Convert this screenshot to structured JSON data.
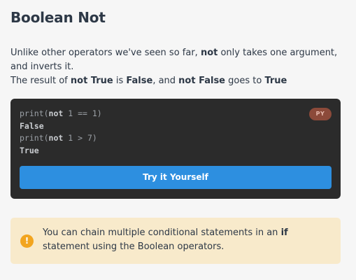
{
  "lesson": {
    "title": "Boolean Not",
    "desc_line1_a": "Unlike other operators we've seen so far, ",
    "desc_line1_bold": "not",
    "desc_line1_b": " only takes one argument, and inverts it.",
    "desc_line2_a": "The result of ",
    "desc_line2_bold1": "not True",
    "desc_line2_b": " is ",
    "desc_line2_bold2": "False",
    "desc_line2_c": ", and ",
    "desc_line2_bold3": "not False",
    "desc_line2_d": " goes to ",
    "desc_line2_bold4": "True"
  },
  "code_card": {
    "line1_pre": "print(",
    "line1_kw": "not",
    "line1_post": " 1 == 1)",
    "line2": "False",
    "line3_pre": "print(",
    "line3_kw": "not",
    "line3_post": " 1 > 7)",
    "line4": "True",
    "lang_badge": "PY",
    "try_button": "Try it Yourself"
  },
  "note": {
    "icon": "exclamation-icon",
    "icon_glyph": "!",
    "text_a": "You can chain multiple conditional statements in an ",
    "text_bold": "if",
    "text_b": " statement using the Boolean operators."
  },
  "colors": {
    "page_bg": "#f6f6f6",
    "code_bg": "#2b2b2b",
    "button_bg": "#2d8fe0",
    "badge_bg": "#8c4a3a",
    "note_bg": "#f8eacb",
    "warn_icon": "#f2a51f"
  }
}
